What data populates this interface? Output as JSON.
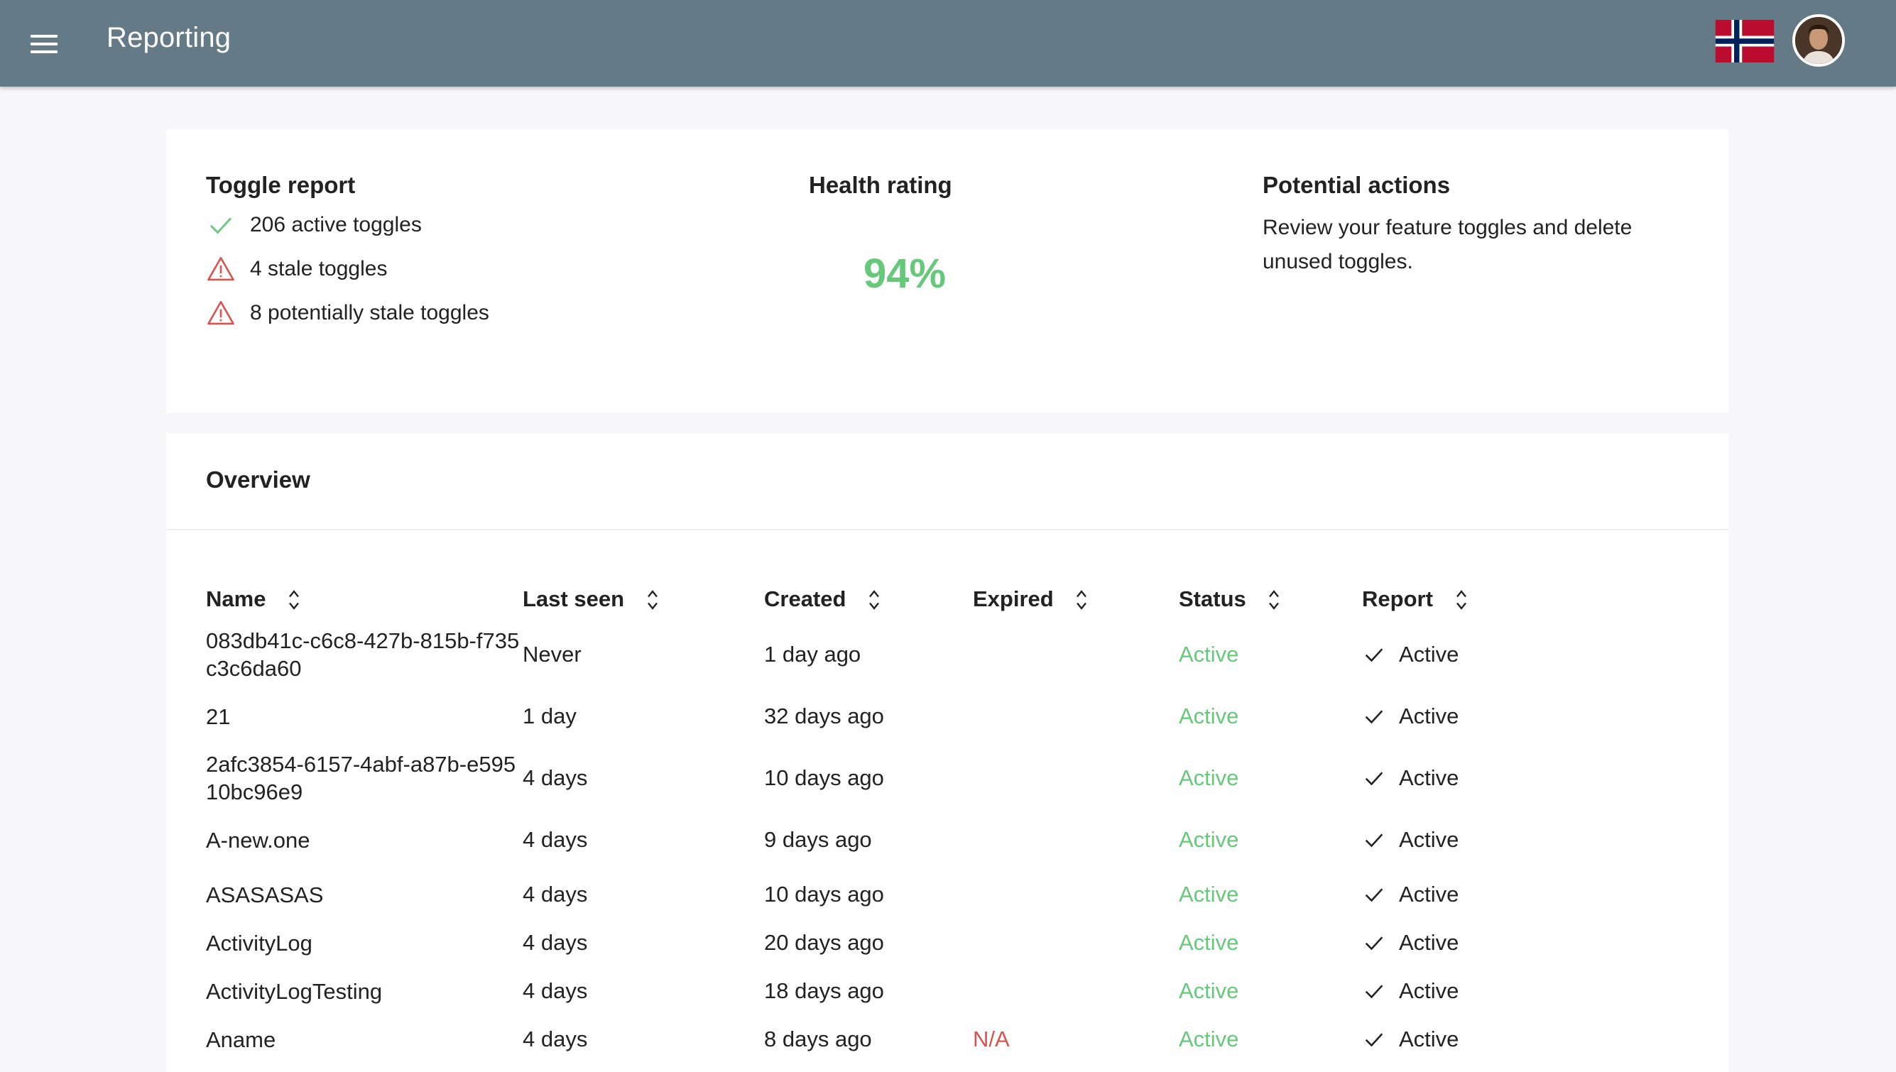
{
  "appbar": {
    "title": "Reporting",
    "color": "#647b87"
  },
  "summary": {
    "toggle_report": {
      "title": "Toggle report",
      "active": "206 active toggles",
      "stale": "4 stale toggles",
      "potentially_stale": "8 potentially stale toggles"
    },
    "health": {
      "title": "Health rating",
      "value": "94%",
      "color": "#66c97a"
    },
    "actions": {
      "title": "Potential actions",
      "text": "Review your feature toggles and delete unused toggles."
    }
  },
  "overview": {
    "title": "Overview",
    "columns": {
      "name": "Name",
      "last_seen": "Last seen",
      "created": "Created",
      "expired": "Expired",
      "status": "Status",
      "report": "Report"
    },
    "rows": [
      {
        "name": "083db41c-c6c8-427b-815b-f735c3c6da60",
        "last_seen": "Never",
        "created": "1 day ago",
        "expired": "",
        "status": "Active",
        "report": "Active"
      },
      {
        "name": "21",
        "last_seen": "1 day",
        "created": "32 days ago",
        "expired": "",
        "status": "Active",
        "report": "Active"
      },
      {
        "name": "2afc3854-6157-4abf-a87b-e59510bc96e9",
        "last_seen": "4 days",
        "created": "10 days ago",
        "expired": "",
        "status": "Active",
        "report": "Active"
      },
      {
        "name": "A-new.one",
        "last_seen": "4 days",
        "created": "9 days ago",
        "expired": "",
        "status": "Active",
        "report": "Active"
      },
      {
        "name": "ASASASAS",
        "last_seen": "4 days",
        "created": "10 days ago",
        "expired": "",
        "status": "Active",
        "report": "Active"
      },
      {
        "name": "ActivityLog",
        "last_seen": "4 days",
        "created": "20 days ago",
        "expired": "",
        "status": "Active",
        "report": "Active"
      },
      {
        "name": "ActivityLogTesting",
        "last_seen": "4 days",
        "created": "18 days ago",
        "expired": "",
        "status": "Active",
        "report": "Active"
      },
      {
        "name": "Aname",
        "last_seen": "4 days",
        "created": "8 days ago",
        "expired": "N/A",
        "status": "Active",
        "report": "Active"
      }
    ]
  },
  "colors": {
    "active": "#66c97a",
    "warning": "#d9534f"
  }
}
